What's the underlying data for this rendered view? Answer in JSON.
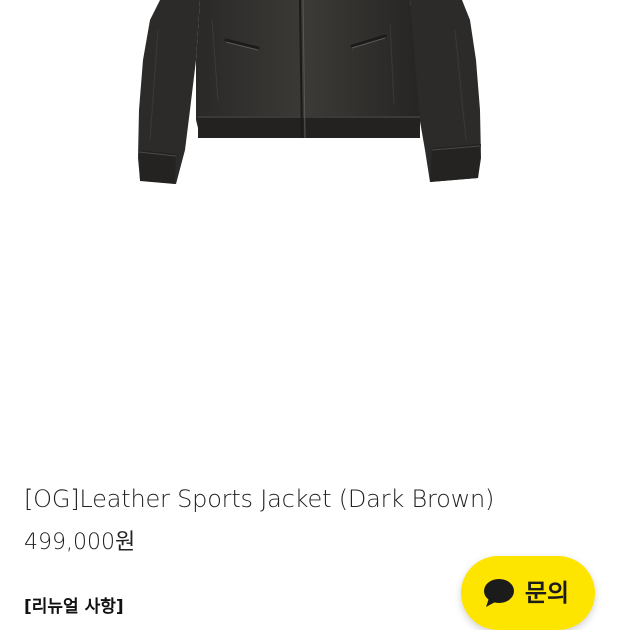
{
  "product": {
    "title": "[OG]Leather Sports Jacket (Dark Brown)",
    "price": "499,000원",
    "section_label": "[리뉴얼 사항]",
    "image_icon": "jacket-photo"
  },
  "chat_button": {
    "label": "문의",
    "icon": "speech-bubble-icon",
    "color": "#fee500"
  }
}
